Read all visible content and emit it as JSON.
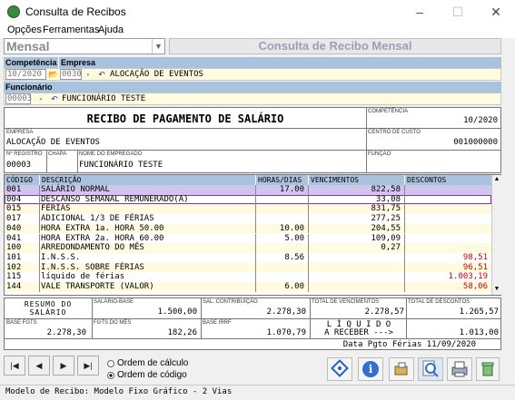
{
  "window": {
    "title": "Consulta de Recibos"
  },
  "menu": [
    "Opções",
    "Ferramentas",
    "Ajuda"
  ],
  "mode_combo": {
    "value": "Mensal"
  },
  "heading": "Consulta de Recibo Mensal",
  "competencia": {
    "label": "Competência",
    "value": "10/2020"
  },
  "empresa": {
    "label": "Empresa",
    "code": "0030",
    "name": "ALOCAÇÃO DE EVENTOS"
  },
  "funcionario": {
    "label": "Funcionário",
    "code": "00003",
    "name": "FUNCIONÁRIO TESTE"
  },
  "receipt": {
    "title": "RECIBO DE PAGAMENTO DE SALÁRIO",
    "competencia_label": "COMPETÊNCIA",
    "competencia": "10/2020",
    "empresa_label": "EMPRESA",
    "empresa": "ALOCAÇÃO DE EVENTOS",
    "cc_label": "CENTRO DE CUSTO",
    "cc": "001000000",
    "registro_label": "Nº REGISTRO",
    "registro": "00003",
    "chapa_label": "CHAPA",
    "nome_label": "NOME DO EMPREGADO",
    "nome": "FUNCIONÁRIO TESTE",
    "funcao_label": "FUNÇÃO"
  },
  "grid": {
    "headers": [
      "CÓDIGO",
      "DESCRIÇÃO",
      "HORAS/DIAS",
      "VENCIMENTOS",
      "DESCONTOS"
    ],
    "rows": [
      {
        "code": "001",
        "desc": "SALÁRIO NORMAL",
        "hours": "17.00",
        "venc": "822,58",
        "desc_val": ""
      },
      {
        "code": "004",
        "desc": "DESCANSO SEMANAL REMUNERADO(A)",
        "hours": "",
        "venc": "33,08",
        "desc_val": ""
      },
      {
        "code": "015",
        "desc": "FÉRIAS",
        "hours": "",
        "venc": "831,75",
        "desc_val": ""
      },
      {
        "code": "017",
        "desc": "ADICIONAL 1/3 DE FÉRIAS",
        "hours": "",
        "venc": "277,25",
        "desc_val": ""
      },
      {
        "code": "040",
        "desc": "HORA EXTRA 1a. HORA 50.00",
        "hours": "10.00",
        "venc": "204,55",
        "desc_val": ""
      },
      {
        "code": "041",
        "desc": "HORA EXTRA 2a. HORA 60.00",
        "hours": "5.00",
        "venc": "109,09",
        "desc_val": ""
      },
      {
        "code": "100",
        "desc": "ARREDONDAMENTO DO MÊS",
        "hours": "",
        "venc": "0,27",
        "desc_val": ""
      },
      {
        "code": "101",
        "desc": "I.N.S.S.",
        "hours": "8.56",
        "venc": "",
        "desc_val": "98,51"
      },
      {
        "code": "102",
        "desc": "I.N.S.S. SOBRE FÉRIAS",
        "hours": "",
        "venc": "",
        "desc_val": "96,51"
      },
      {
        "code": "115",
        "desc": "líquido de férias",
        "hours": "",
        "venc": "",
        "desc_val": "1.003,19"
      },
      {
        "code": "144",
        "desc": "VALE TRANSPORTE (VALOR)",
        "hours": "6.00",
        "venc": "",
        "desc_val": "58,06"
      }
    ]
  },
  "totals": {
    "resumo": "RESUMO DO SALÁRIO",
    "sal_base_label": "SALÁRIO-BASE",
    "sal_base": "1.500,00",
    "sal_contrib_label": "SAL. CONTRIBUIÇÃO",
    "sal_contrib": "2.278,30",
    "total_venc_label": "TOTAL DE VENCIMENTOS",
    "total_venc": "2.278,57",
    "total_desc_label": "TOTAL DE DESCONTOS",
    "total_desc": "1.265,57",
    "base_fgts_label": "BASE FGTS",
    "base_fgts": "2.278,30",
    "fgts_mes_label": "FGTS DO MÊS",
    "fgts_mes": "182,26",
    "base_irrf_label": "BASE IRRF",
    "base_irrf": "1.070,79",
    "liquido_label": "L Í Q U I D O",
    "receber_label": "A RECEBER --->",
    "liquido": "1.013,00",
    "data_pgto": "Data Pgto Férias 11/09/2020"
  },
  "order": {
    "calc": "Ordem de cálculo",
    "code": "Ordem de código"
  },
  "status": "Modelo de Recibo: Modelo Fixo Gráfico - 2 Vias"
}
